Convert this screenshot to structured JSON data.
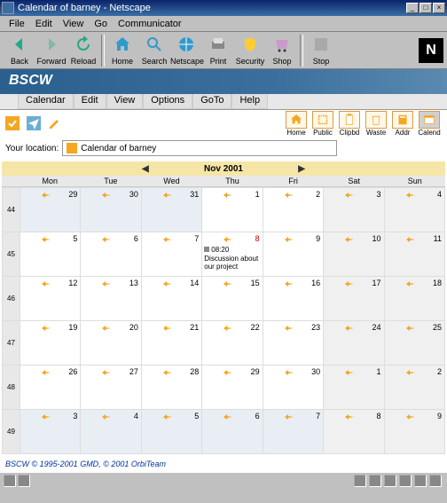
{
  "window": {
    "title": "Calendar of barney - Netscape"
  },
  "menubar": [
    "File",
    "Edit",
    "View",
    "Go",
    "Communicator"
  ],
  "toolbar": [
    {
      "label": "Back",
      "icon": "back"
    },
    {
      "label": "Forward",
      "icon": "forward"
    },
    {
      "label": "Reload",
      "icon": "reload"
    },
    {
      "label": "Home",
      "icon": "home"
    },
    {
      "label": "Search",
      "icon": "search"
    },
    {
      "label": "Netscape",
      "icon": "netscape"
    },
    {
      "label": "Print",
      "icon": "print"
    },
    {
      "label": "Security",
      "icon": "security"
    },
    {
      "label": "Shop",
      "icon": "shop"
    },
    {
      "label": "Stop",
      "icon": "stop"
    }
  ],
  "app": {
    "brand": "BSCW"
  },
  "app_menu": [
    "Calendar",
    "Edit",
    "View",
    "Options",
    "GoTo",
    "Help"
  ],
  "nav_boxes": [
    {
      "label": "Home",
      "icon": "home"
    },
    {
      "label": "Public",
      "icon": "public"
    },
    {
      "label": "Clipbd",
      "icon": "clipbd"
    },
    {
      "label": "Waste",
      "icon": "waste"
    },
    {
      "label": "Addr",
      "icon": "addr"
    },
    {
      "label": "Calend",
      "icon": "calend",
      "selected": true
    }
  ],
  "location": {
    "label": "Your location:",
    "value": "Calendar of barney"
  },
  "calendar": {
    "title": "Nov 2001",
    "day_headers": [
      "Mon",
      "Tue",
      "Wed",
      "Thu",
      "Fri",
      "Sat",
      "Sun"
    ],
    "weeks": [
      {
        "num": 44,
        "days": [
          {
            "n": 29,
            "other": true
          },
          {
            "n": 30,
            "other": true
          },
          {
            "n": 31,
            "other": true
          },
          {
            "n": 1
          },
          {
            "n": 2
          },
          {
            "n": 3,
            "wkend": true
          },
          {
            "n": 4,
            "wkend": true
          }
        ]
      },
      {
        "num": 45,
        "days": [
          {
            "n": 5
          },
          {
            "n": 6
          },
          {
            "n": 7
          },
          {
            "n": 8,
            "red": true,
            "event": {
              "time": "08:20",
              "text": "Discussion about our project"
            }
          },
          {
            "n": 9
          },
          {
            "n": 10,
            "wkend": true
          },
          {
            "n": 11,
            "wkend": true
          }
        ]
      },
      {
        "num": 46,
        "days": [
          {
            "n": 12
          },
          {
            "n": 13
          },
          {
            "n": 14
          },
          {
            "n": 15
          },
          {
            "n": 16
          },
          {
            "n": 17,
            "wkend": true
          },
          {
            "n": 18,
            "wkend": true
          }
        ]
      },
      {
        "num": 47,
        "days": [
          {
            "n": 19
          },
          {
            "n": 20
          },
          {
            "n": 21
          },
          {
            "n": 22
          },
          {
            "n": 23
          },
          {
            "n": 24,
            "wkend": true
          },
          {
            "n": 25,
            "wkend": true
          }
        ]
      },
      {
        "num": 48,
        "days": [
          {
            "n": 26
          },
          {
            "n": 27
          },
          {
            "n": 28
          },
          {
            "n": 29
          },
          {
            "n": 30
          },
          {
            "n": 1,
            "other": true,
            "wkend": true
          },
          {
            "n": 2,
            "other": true,
            "wkend": true
          }
        ]
      },
      {
        "num": 49,
        "days": [
          {
            "n": 3,
            "other": true
          },
          {
            "n": 4,
            "other": true
          },
          {
            "n": 5,
            "other": true
          },
          {
            "n": 6,
            "other": true
          },
          {
            "n": 7,
            "other": true
          },
          {
            "n": 8,
            "other": true,
            "wkend": true
          },
          {
            "n": 9,
            "other": true,
            "wkend": true
          }
        ]
      }
    ]
  },
  "footer": {
    "text1": "BSCW © 1995-2001 ",
    "link1": "GMD",
    "text2": ", © 2001 ",
    "link2": "OrbiTeam"
  }
}
